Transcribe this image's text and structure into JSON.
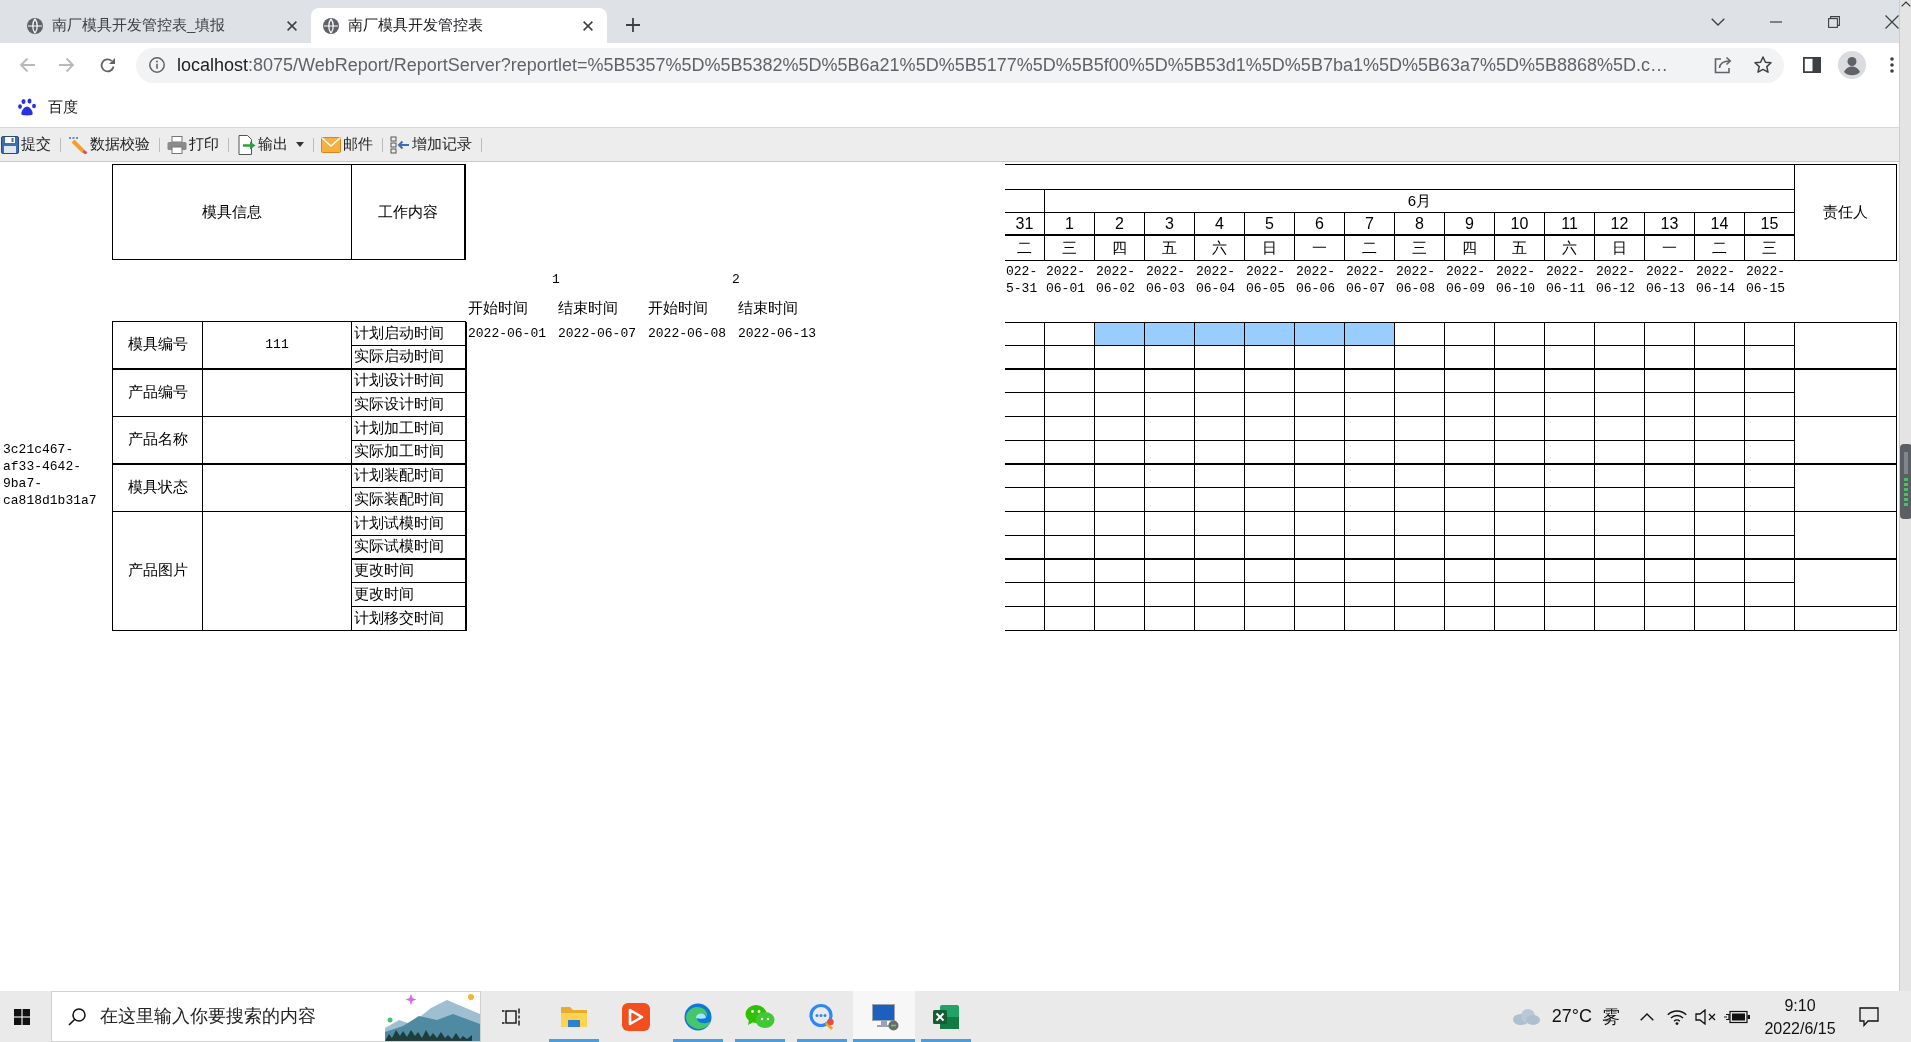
{
  "browser": {
    "tabs": [
      {
        "title": "南厂模具开发管控表_填报",
        "selected": false
      },
      {
        "title": "南厂模具开发管控表",
        "selected": true
      }
    ],
    "url": {
      "host": "localhost",
      "path": ":8075/WebReport/ReportServer?reportlet=%5B5357%5D%5B5382%5D%5B6a21%5D%5B5177%5D%5B5f00%5D%5B53d1%5D%5B7ba1%5D%5B63a7%5D%5B8868%5D.c…"
    },
    "bookmarks": [
      {
        "label": "百度"
      }
    ]
  },
  "toolbar": [
    {
      "label": "提交",
      "dropdown": false
    },
    {
      "label": "数据校验",
      "dropdown": false
    },
    {
      "label": "打印",
      "dropdown": false
    },
    {
      "label": "输出",
      "dropdown": true
    },
    {
      "label": "邮件",
      "dropdown": false
    },
    {
      "label": "增加记录",
      "dropdown": false
    }
  ],
  "report": {
    "headers": [
      "模具信息",
      "工作内容"
    ],
    "id_text": "3c21c467-af33-4642-9ba7-ca818d1b31a7",
    "phases": [
      {
        "number": "1",
        "start_label": "开始时间",
        "end_label": "结束时间",
        "start": "2022-06-01",
        "end": "2022-06-07"
      },
      {
        "number": "2",
        "start_label": "开始时间",
        "end_label": "结束时间",
        "start": "2022-06-08",
        "end": "2022-06-13"
      }
    ],
    "groups": [
      {
        "label": "模具编号",
        "value": "111",
        "items": [
          "计划启动时间",
          "实际启动时间"
        ]
      },
      {
        "label": "产品编号",
        "items": [
          "计划设计时间",
          "实际设计时间"
        ]
      },
      {
        "label": "产品名称",
        "items": [
          "计划加工时间",
          "实际加工时间"
        ]
      },
      {
        "label": "模具状态",
        "items": [
          "计划装配时间",
          "实际装配时间"
        ]
      },
      {
        "label": "产品图片",
        "items": [
          "计划试模时间",
          "实际试模时间",
          "更改时间",
          "更改时间",
          "计划移交时间"
        ]
      }
    ]
  },
  "calendar": {
    "month": "6月",
    "owner_header": "责任人",
    "days": [
      {
        "day": "31",
        "weekday": "二",
        "date": "022-5-31"
      },
      {
        "day": "1",
        "weekday": "三",
        "date": "2022-06-01"
      },
      {
        "day": "2",
        "weekday": "四",
        "date": "2022-06-02"
      },
      {
        "day": "3",
        "weekday": "五",
        "date": "2022-06-03"
      },
      {
        "day": "4",
        "weekday": "六",
        "date": "2022-06-04"
      },
      {
        "day": "5",
        "weekday": "日",
        "date": "2022-06-05"
      },
      {
        "day": "6",
        "weekday": "一",
        "date": "2022-06-06"
      },
      {
        "day": "7",
        "weekday": "二",
        "date": "2022-06-07"
      },
      {
        "day": "8",
        "weekday": "三",
        "date": "2022-06-08"
      },
      {
        "day": "9",
        "weekday": "四",
        "date": "2022-06-09"
      },
      {
        "day": "10",
        "weekday": "五",
        "date": "2022-06-10"
      },
      {
        "day": "11",
        "weekday": "六",
        "date": "2022-06-11"
      },
      {
        "day": "12",
        "weekday": "日",
        "date": "2022-06-12"
      },
      {
        "day": "13",
        "weekday": "一",
        "date": "2022-06-13"
      },
      {
        "day": "14",
        "weekday": "二",
        "date": "2022-06-14"
      },
      {
        "day": "15",
        "weekday": "三",
        "date": "2022-06-15"
      }
    ],
    "rows": [
      {
        "filled": [
          false,
          false,
          true,
          true,
          true,
          true,
          true,
          true,
          false,
          false,
          false,
          false,
          false,
          false,
          false,
          false
        ]
      },
      {
        "filled": [
          false,
          false,
          false,
          false,
          false,
          false,
          false,
          false,
          false,
          false,
          false,
          false,
          false,
          false,
          false,
          false
        ]
      },
      {
        "filled": [
          false,
          false,
          false,
          false,
          false,
          false,
          false,
          false,
          false,
          false,
          false,
          false,
          false,
          false,
          false,
          false
        ]
      },
      {
        "filled": [
          false,
          false,
          false,
          false,
          false,
          false,
          false,
          false,
          false,
          false,
          false,
          false,
          false,
          false,
          false,
          false
        ]
      },
      {
        "filled": [
          false,
          false,
          false,
          false,
          false,
          false,
          false,
          false,
          false,
          false,
          false,
          false,
          false,
          false,
          false,
          false
        ]
      },
      {
        "filled": [
          false,
          false,
          false,
          false,
          false,
          false,
          false,
          false,
          false,
          false,
          false,
          false,
          false,
          false,
          false,
          false
        ]
      },
      {
        "filled": [
          false,
          false,
          false,
          false,
          false,
          false,
          false,
          false,
          false,
          false,
          false,
          false,
          false,
          false,
          false,
          false
        ]
      },
      {
        "filled": [
          false,
          false,
          false,
          false,
          false,
          false,
          false,
          false,
          false,
          false,
          false,
          false,
          false,
          false,
          false,
          false
        ]
      },
      {
        "filled": [
          false,
          false,
          false,
          false,
          false,
          false,
          false,
          false,
          false,
          false,
          false,
          false,
          false,
          false,
          false,
          false
        ]
      },
      {
        "filled": [
          false,
          false,
          false,
          false,
          false,
          false,
          false,
          false,
          false,
          false,
          false,
          false,
          false,
          false,
          false,
          false
        ]
      },
      {
        "filled": [
          false,
          false,
          false,
          false,
          false,
          false,
          false,
          false,
          false,
          false,
          false,
          false,
          false,
          false,
          false,
          false
        ]
      },
      {
        "filled": [
          false,
          false,
          false,
          false,
          false,
          false,
          false,
          false,
          false,
          false,
          false,
          false,
          false,
          false,
          false,
          false
        ]
      },
      {
        "filled": [
          false,
          false,
          false,
          false,
          false,
          false,
          false,
          false,
          false,
          false,
          false,
          false,
          false,
          false,
          false,
          false
        ]
      }
    ]
  },
  "taskbar": {
    "search": {
      "placeholder": "在这里输入你要搜索的内容"
    },
    "apps": [
      {
        "running": true,
        "active": false
      },
      {
        "running": false,
        "active": false
      },
      {
        "running": true,
        "active": false
      },
      {
        "running": true,
        "active": false
      },
      {
        "running": true,
        "active": false
      },
      {
        "running": true,
        "active": true
      },
      {
        "running": true,
        "active": false
      }
    ],
    "weather": {
      "temperature": "27°C",
      "condition": "雾"
    },
    "clock": {
      "time": "9:10",
      "date": "2022/6/15"
    }
  }
}
